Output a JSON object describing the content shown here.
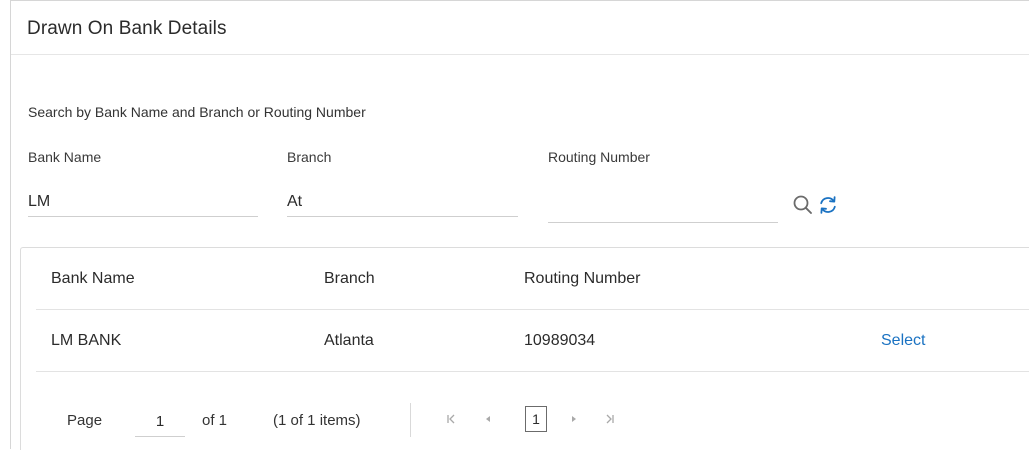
{
  "panel": {
    "title": "Drawn On Bank Details"
  },
  "search": {
    "hint": "Search by Bank Name and Branch or Routing Number",
    "bank_name": {
      "label": "Bank Name",
      "value": "LM"
    },
    "branch": {
      "label": "Branch",
      "value": "At"
    },
    "routing_number": {
      "label": "Routing Number",
      "value": ""
    }
  },
  "icons": {
    "search": "search-icon",
    "reset": "refresh-icon"
  },
  "colors": {
    "link": "#1a72c2",
    "search_icon": "#6b6b6b",
    "reset_icon": "#1a72c2"
  },
  "results": {
    "columns": [
      "Bank Name",
      "Branch",
      "Routing Number"
    ],
    "rows": [
      {
        "bank_name": "LM BANK",
        "branch": "Atlanta",
        "routing_number": "10989034",
        "action": "Select"
      }
    ]
  },
  "pager": {
    "page_label": "Page",
    "current_page": "1",
    "of_label": "of 1",
    "items_label": "(1 of 1 items)",
    "page_button": "1",
    "first_icon": "first-page-icon",
    "prev_icon": "prev-page-icon",
    "next_icon": "next-page-icon",
    "last_icon": "last-page-icon"
  }
}
